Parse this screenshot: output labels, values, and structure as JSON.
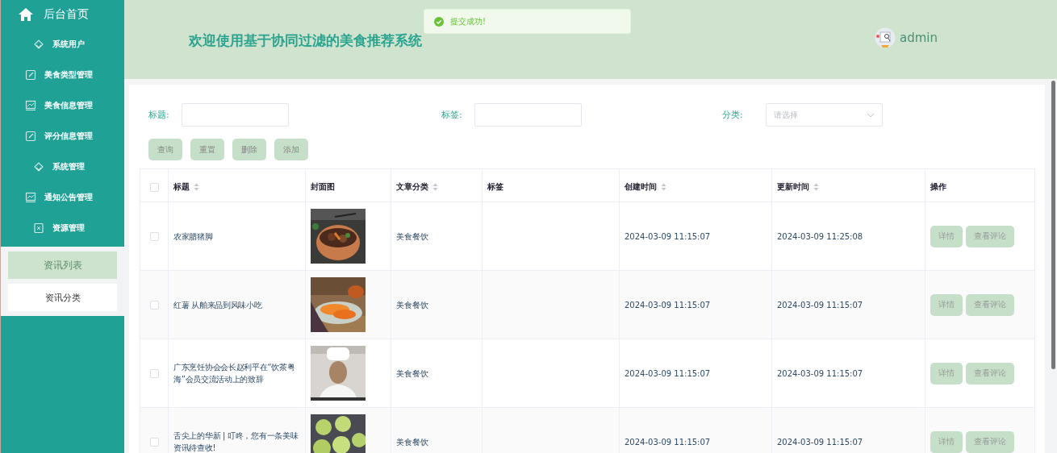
{
  "sidebar": {
    "home": {
      "label": "后台首页"
    },
    "items": [
      {
        "label": "系统用户",
        "kind": "diamond"
      },
      {
        "label": "美食类型管理",
        "kind": "edit"
      },
      {
        "label": "美食信息管理",
        "kind": "chart"
      },
      {
        "label": "评分信息管理",
        "kind": "edit"
      },
      {
        "label": "系统管理",
        "kind": "diamond"
      },
      {
        "label": "通知公告管理",
        "kind": "chart"
      },
      {
        "label": "资源管理",
        "kind": "doc"
      }
    ],
    "submenu": [
      {
        "label": "资讯列表",
        "selected": true
      },
      {
        "label": "资讯分类",
        "selected": false
      }
    ]
  },
  "header": {
    "title": "欢迎使用基于协同过滤的美食推荐系统",
    "user": "admin"
  },
  "toast": {
    "message": "提交成功!"
  },
  "filters": [
    {
      "label": "标题:",
      "kind": "text"
    },
    {
      "label": "标签:",
      "kind": "text"
    },
    {
      "label": "分类:",
      "kind": "select",
      "placeholder": "请选择"
    }
  ],
  "buttons": [
    "查询",
    "重置",
    "删除",
    "添加"
  ],
  "table": {
    "select_all": {
      "checked": false
    },
    "columns": [
      {
        "label": "标题",
        "sortable": true
      },
      {
        "label": "封面图",
        "sortable": false
      },
      {
        "label": "文章分类",
        "sortable": true
      },
      {
        "label": "标签",
        "sortable": false
      },
      {
        "label": "创建时间",
        "sortable": true
      },
      {
        "label": "更新时间",
        "sortable": true
      },
      {
        "label": "操作",
        "sortable": false
      }
    ],
    "rows": [
      {
        "checked": false,
        "title": "农家腊猪脚",
        "cover": {
          "kind": "picture"
        },
        "category": "美食餐饮",
        "created": "2024-03-09 11:15:07",
        "updated": "2024-03-09 11:25:08",
        "actions": [
          "详情",
          "查看评论"
        ]
      },
      {
        "checked": false,
        "title": "红薯 从舶来品到风味小吃",
        "cover": {
          "kind": "picture"
        },
        "category": "美食餐饮",
        "created": "2024-03-09 11:15:07",
        "updated": "2024-03-09 11:15:07",
        "actions": [
          "详情",
          "查看评论"
        ]
      },
      {
        "checked": false,
        "title": "广东烹饪协会会长赵利平在“饮茶粤海”会员交流活动上的致辞",
        "cover": {
          "kind": "picture"
        },
        "category": "美食餐饮",
        "created": "2024-03-09 11:15:07",
        "updated": "2024-03-09 11:15:07",
        "actions": [
          "详情",
          "查看评论"
        ]
      },
      {
        "checked": false,
        "title": "舌尖上的华新 | 叮咚，您有一条美味资讯待查收!",
        "cover": {
          "kind": "picture"
        },
        "category": "美食餐饮",
        "created": "2024-03-09 11:15:07",
        "updated": "2024-03-09 11:15:07",
        "actions": [
          "详情",
          "查看评论"
        ]
      }
    ]
  }
}
